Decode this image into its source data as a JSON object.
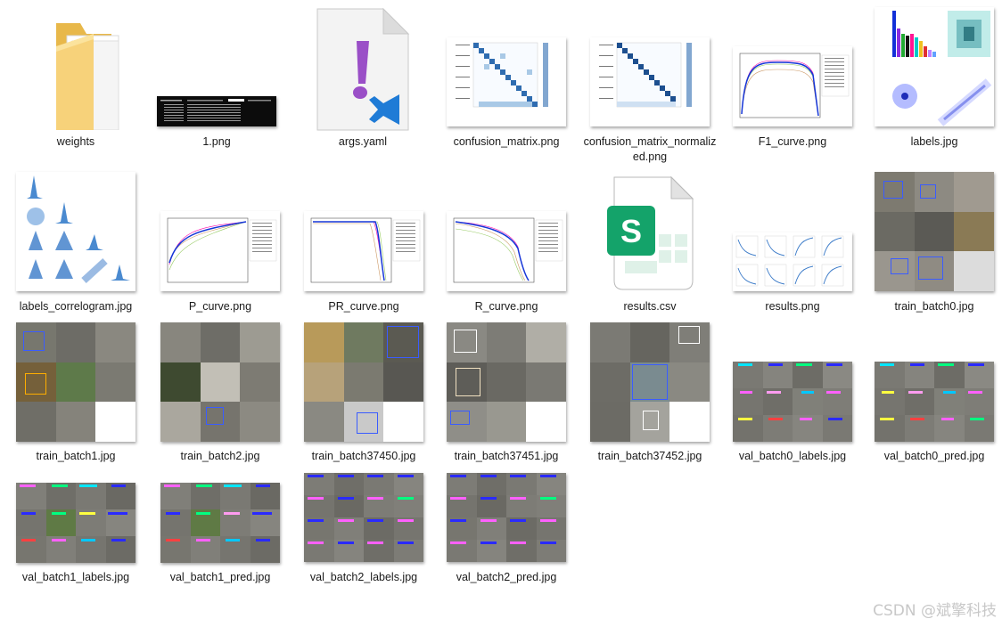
{
  "files": [
    {
      "name": "weights",
      "kind": "folder-icon"
    },
    {
      "name": "1.png",
      "kind": "terminal-screenshot"
    },
    {
      "name": "args.yaml",
      "kind": "yaml-file-icon"
    },
    {
      "name": "confusion_matrix.png",
      "kind": "matrix-plot"
    },
    {
      "name": "confusion_matrix_normalized.png",
      "kind": "matrix-plot"
    },
    {
      "name": "F1_curve.png",
      "kind": "curve-plot"
    },
    {
      "name": "labels.jpg",
      "kind": "labels-plot"
    },
    {
      "name": "labels_correlogram.jpg",
      "kind": "correlogram-plot"
    },
    {
      "name": "P_curve.png",
      "kind": "curve-plot"
    },
    {
      "name": "PR_curve.png",
      "kind": "curve-plot"
    },
    {
      "name": "R_curve.png",
      "kind": "curve-plot"
    },
    {
      "name": "results.csv",
      "kind": "spreadsheet-file-icon"
    },
    {
      "name": "results.png",
      "kind": "results-plot"
    },
    {
      "name": "train_batch0.jpg",
      "kind": "photo-mosaic"
    },
    {
      "name": "train_batch1.jpg",
      "kind": "photo-mosaic"
    },
    {
      "name": "train_batch2.jpg",
      "kind": "photo-mosaic"
    },
    {
      "name": "train_batch37450.jpg",
      "kind": "photo-mosaic"
    },
    {
      "name": "train_batch37451.jpg",
      "kind": "photo-mosaic"
    },
    {
      "name": "train_batch37452.jpg",
      "kind": "photo-mosaic"
    },
    {
      "name": "val_batch0_labels.jpg",
      "kind": "photo-mosaic"
    },
    {
      "name": "val_batch0_pred.jpg",
      "kind": "photo-mosaic"
    },
    {
      "name": "val_batch1_labels.jpg",
      "kind": "photo-mosaic"
    },
    {
      "name": "val_batch1_pred.jpg",
      "kind": "photo-mosaic"
    },
    {
      "name": "val_batch2_labels.jpg",
      "kind": "photo-mosaic"
    },
    {
      "name": "val_batch2_pred.jpg",
      "kind": "photo-mosaic"
    }
  ],
  "watermark": "CSDN @斌擎科技",
  "yaml_icon_glyph": "!",
  "csv_icon_glyph": "S"
}
